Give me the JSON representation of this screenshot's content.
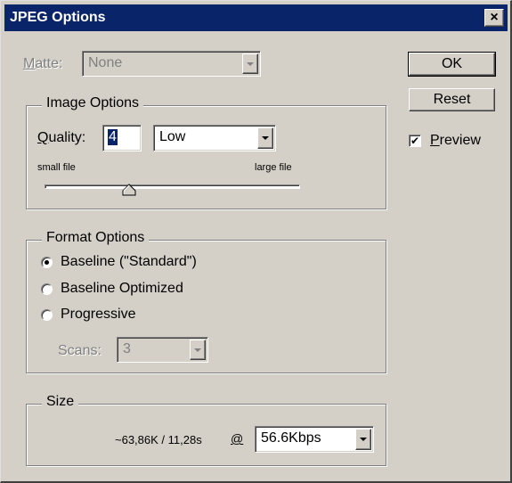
{
  "window": {
    "title": "JPEG Options",
    "close_symbol": "×"
  },
  "matte": {
    "label_first": "M",
    "label_rest": "atte:",
    "value": "None"
  },
  "image_options": {
    "legend": "Image Options",
    "quality_label_first": "Q",
    "quality_label_rest": "uality:",
    "quality_value": "4",
    "quality_preset": "Low",
    "slider_left_label": "small file",
    "slider_right_label": "large file",
    "slider_level_percent": 33
  },
  "format_options": {
    "legend": "Format Options",
    "options": [
      {
        "label": "Baseline (\"Standard\")",
        "selected": true
      },
      {
        "label": "Baseline Optimized",
        "selected": false
      },
      {
        "label": "Progressive",
        "selected": false
      }
    ],
    "scans_label": "Scans:",
    "scans_value": "3"
  },
  "size": {
    "legend": "Size",
    "estimate": "~63,86K / 11,28s",
    "at_symbol": "@",
    "connection_speed": "56.6Kbps"
  },
  "buttons": {
    "ok": "OK",
    "reset": "Reset"
  },
  "preview": {
    "label_first": "P",
    "label_rest": "review",
    "checked": true,
    "check_symbol": "✔"
  }
}
